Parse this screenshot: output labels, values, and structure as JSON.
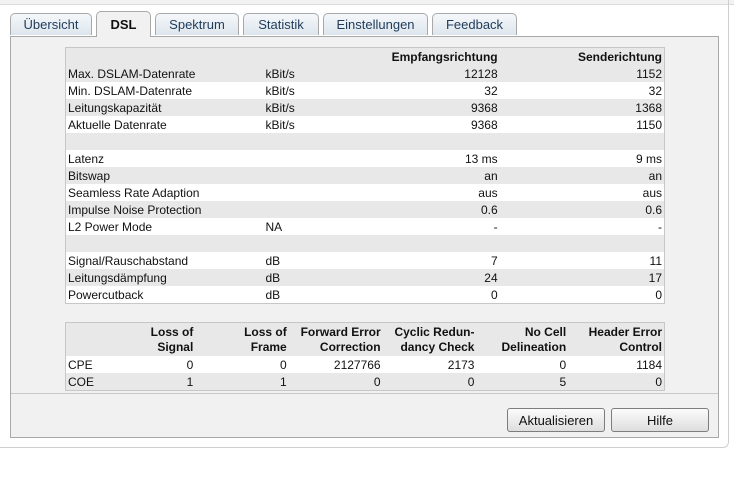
{
  "tabs": [
    {
      "label": "Übersicht"
    },
    {
      "label": "DSL"
    },
    {
      "label": "Spektrum"
    },
    {
      "label": "Statistik"
    },
    {
      "label": "Einstellungen"
    },
    {
      "label": "Feedback"
    }
  ],
  "active_tab": "DSL",
  "rates": {
    "headers": {
      "col1": "",
      "col2": "",
      "col3": "Empfangsrichtung",
      "col4": "Senderichtung"
    },
    "rows": [
      {
        "label": "Max. DSLAM-Datenrate",
        "unit": "kBit/s",
        "rx": "12128",
        "tx": "1152"
      },
      {
        "label": "Min. DSLAM-Datenrate",
        "unit": "kBit/s",
        "rx": "32",
        "tx": "32"
      },
      {
        "label": "Leitungskapazität",
        "unit": "kBit/s",
        "rx": "9368",
        "tx": "1368"
      },
      {
        "label": "Aktuelle Datenrate",
        "unit": "kBit/s",
        "rx": "9368",
        "tx": "1150"
      },
      {
        "label": "",
        "unit": "",
        "rx": "",
        "tx": ""
      },
      {
        "label": "Latenz",
        "unit": "",
        "rx": "13 ms",
        "tx": "9 ms"
      },
      {
        "label": "Bitswap",
        "unit": "",
        "rx": "an",
        "tx": "an"
      },
      {
        "label": "Seamless Rate Adaption",
        "unit": "",
        "rx": "aus",
        "tx": "aus"
      },
      {
        "label": "Impulse Noise Protection",
        "unit": "",
        "rx": "0.6",
        "tx": "0.6"
      },
      {
        "label": "L2 Power Mode",
        "unit": "NA",
        "rx": "-",
        "tx": "-"
      },
      {
        "label": "",
        "unit": "",
        "rx": "",
        "tx": ""
      },
      {
        "label": "Signal/Rauschabstand",
        "unit": "dB",
        "rx": "7",
        "tx": "11"
      },
      {
        "label": "Leitungsdämpfung",
        "unit": "dB",
        "rx": "24",
        "tx": "17"
      },
      {
        "label": "Powercutback",
        "unit": "dB",
        "rx": "0",
        "tx": "0"
      }
    ]
  },
  "errors": {
    "headers": [
      {
        "line1": "Loss of",
        "line2": "Signal"
      },
      {
        "line1": "Loss of",
        "line2": "Frame"
      },
      {
        "line1": "Forward Error",
        "line2": "Correction"
      },
      {
        "line1": "Cyclic Redun-",
        "line2": "dancy Check"
      },
      {
        "line1": "No Cell",
        "line2": "Delineation"
      },
      {
        "line1": "Header Error",
        "line2": "Control"
      }
    ],
    "rows": [
      {
        "label": "CPE",
        "values": [
          "0",
          "0",
          "2127766",
          "2173",
          "0",
          "1184"
        ]
      },
      {
        "label": "COE",
        "values": [
          "1",
          "1",
          "0",
          "0",
          "5",
          "0"
        ]
      }
    ]
  },
  "buttons": {
    "refresh": "Aktualisieren",
    "help": "Hilfe"
  }
}
